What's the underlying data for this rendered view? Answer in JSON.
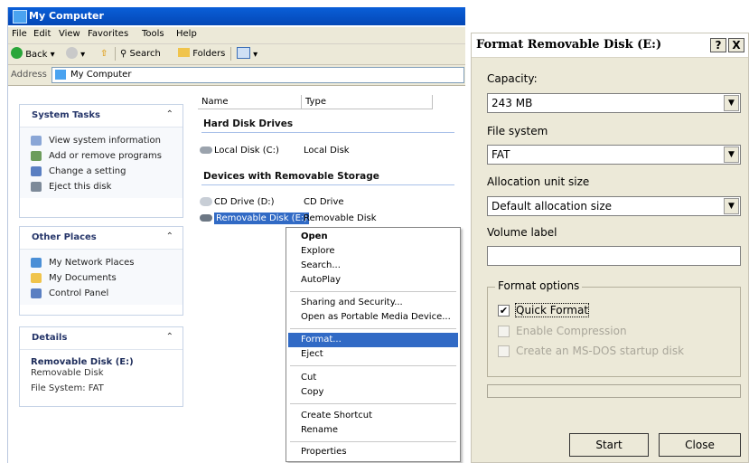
{
  "explorer": {
    "title": "My Computer",
    "menu": [
      "File",
      "Edit",
      "View",
      "Favorites",
      "Tools",
      "Help"
    ],
    "toolbar": {
      "back": "Back",
      "search": "Search",
      "folders": "Folders"
    },
    "address_label": "Address",
    "address_value": "My Computer",
    "panels": {
      "system_tasks": {
        "title": "System Tasks",
        "items": [
          "View system information",
          "Add or remove programs",
          "Change a setting",
          "Eject this disk"
        ]
      },
      "other_places": {
        "title": "Other Places",
        "items": [
          "My Network Places",
          "My Documents",
          "Control Panel"
        ]
      },
      "details": {
        "title": "Details",
        "name": "Removable Disk (E:)",
        "type": "Removable Disk",
        "fs": "File System: FAT"
      }
    },
    "columns": [
      "Name",
      "Type"
    ],
    "groups": {
      "hdd": "Hard Disk Drives",
      "removable": "Devices with Removable Storage"
    },
    "files": [
      {
        "name": "Local Disk (C:)",
        "type": "Local Disk"
      },
      {
        "name": "CD Drive (D:)",
        "type": "CD Drive"
      },
      {
        "name": "Removable Disk (E:)",
        "type": "Removable Disk"
      }
    ],
    "context_menu": [
      "Open",
      "Explore",
      "Search...",
      "AutoPlay",
      "Sharing and Security...",
      "Open as Portable Media Device...",
      "Format...",
      "Eject",
      "Cut",
      "Copy",
      "Create Shortcut",
      "Rename",
      "Properties"
    ]
  },
  "dialog": {
    "title": "Format Removable Disk (E:)",
    "help_btn": "?",
    "close_btn": "X",
    "capacity_label": "Capacity:",
    "capacity_value": "243 MB",
    "fs_label": "File system",
    "fs_value": "FAT",
    "alloc_label": "Allocation unit size",
    "alloc_value": "Default allocation size",
    "volume_label": "Volume label",
    "volume_value": "",
    "options_legend": "Format options",
    "opt_quick": "Quick Format",
    "opt_quick_checked": true,
    "opt_compress": "Enable Compression",
    "opt_msdos": "Create an MS-DOS startup disk",
    "start": "Start",
    "close": "Close"
  }
}
